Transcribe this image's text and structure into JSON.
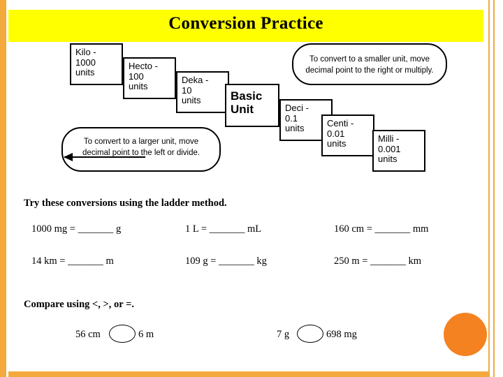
{
  "slide": {
    "title": "Conversion Practice",
    "accent_color": "#f3a93c",
    "title_highlight_color": "#ffff00",
    "circle_color": "#f58220"
  },
  "diagram": {
    "name": "metric-ladder",
    "boxes": [
      {
        "label": "Kilo -\n1000\nunits"
      },
      {
        "label": "Hecto -\n100\nunits"
      },
      {
        "label": "Deka -\n10\nunits"
      },
      {
        "label": "Basic\nUnit"
      },
      {
        "label": "Deci -\n0.1\nunits"
      },
      {
        "label": "Centi -\n0.01\nunits"
      },
      {
        "label": "Milli -\n0.001\nunits"
      }
    ],
    "bubbles": [
      {
        "label": "To convert to a smaller unit, move\ndecimal  point to the right or multiply."
      },
      {
        "label": "To convert to a larger unit, move\ndecimal  point to the left or divide."
      }
    ]
  },
  "worksheet": {
    "conversions_heading": "Try these conversions using the ladder method.",
    "conversions": [
      "1000 mg = _______ g",
      "1 L = _______ mL",
      "160 cm = _______ mm",
      "14 km = _______ m",
      "109 g = _______ kg",
      "250 m = _______ km"
    ],
    "compare_heading": "Compare using <, >, or =.",
    "comparisons": [
      {
        "left": "56 cm",
        "right": "6 m"
      },
      {
        "left": "7 g",
        "right": "698 mg"
      }
    ]
  }
}
